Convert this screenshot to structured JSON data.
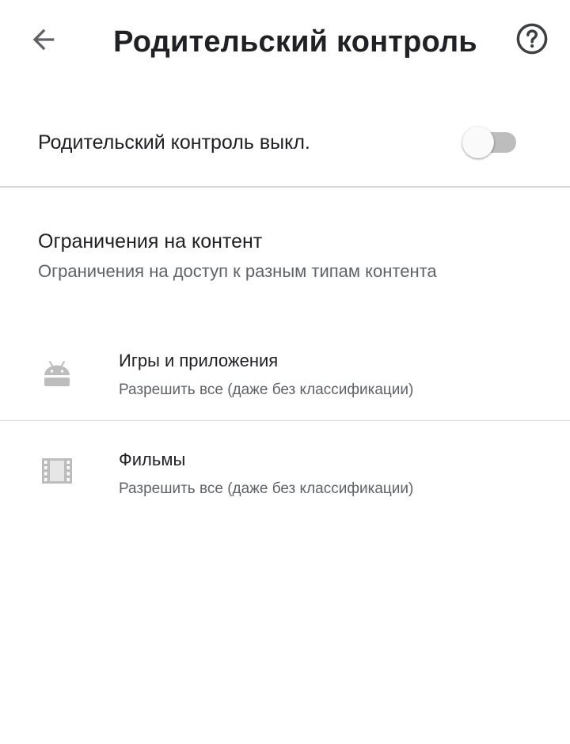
{
  "header": {
    "title": "Родительский контроль",
    "back_icon": "arrow-back-icon",
    "help_icon": "help-circle-icon"
  },
  "master_toggle": {
    "label": "Родительский контроль выкл.",
    "state": "off"
  },
  "content_restrictions": {
    "title": "Ограничения на контент",
    "subtitle": "Ограничения на доступ к разным типам контента",
    "items": [
      {
        "icon": "android-icon",
        "title": "Игры и приложения",
        "subtitle": "Разрешить все (даже без классификации)"
      },
      {
        "icon": "movie-film-icon",
        "title": "Фильмы",
        "subtitle": "Разрешить все (даже без классификации)"
      }
    ]
  },
  "colors": {
    "text_primary": "#202124",
    "text_secondary": "#5f6368",
    "icon_gray": "#bdbdbd",
    "switch_track": "#bdbdbd",
    "switch_thumb": "#fafafa",
    "divider": "#d6d6d6"
  }
}
